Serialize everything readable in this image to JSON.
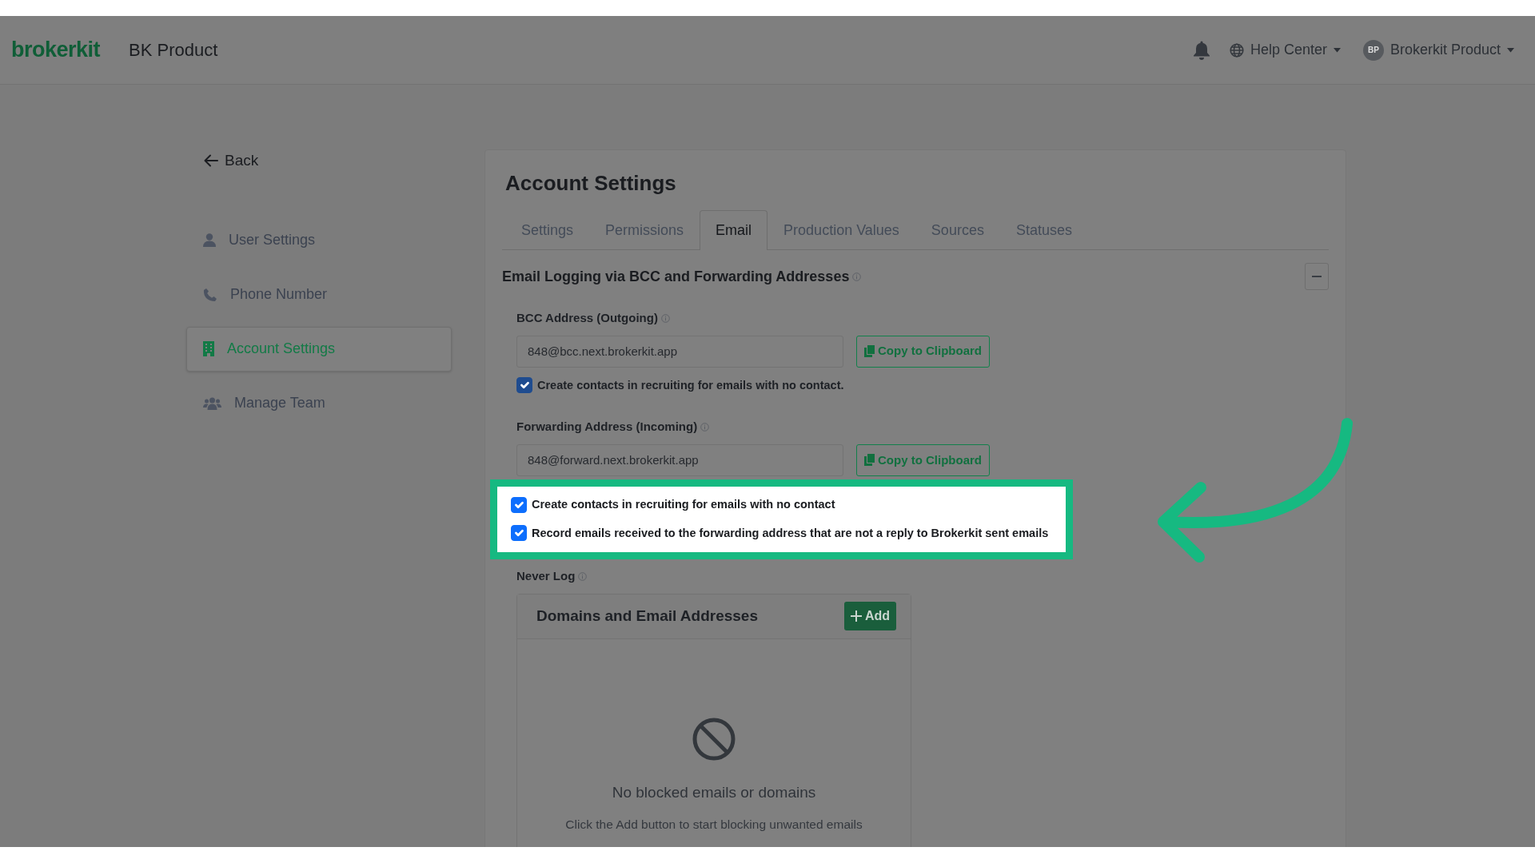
{
  "header": {
    "logo": "brokerkit",
    "workspace": "BK Product",
    "help": "Help Center",
    "avatar": "BP",
    "user": "Brokerkit Product"
  },
  "sidebar": {
    "back": "Back",
    "items": [
      {
        "label": "User Settings",
        "selected": false
      },
      {
        "label": "Phone Number",
        "selected": false
      },
      {
        "label": "Account Settings",
        "selected": true
      },
      {
        "label": "Manage Team",
        "selected": false
      }
    ]
  },
  "main": {
    "title": "Account Settings",
    "tabs": [
      {
        "label": "Settings",
        "selected": false
      },
      {
        "label": "Permissions",
        "selected": false
      },
      {
        "label": "Email",
        "selected": true
      },
      {
        "label": "Production Values",
        "selected": false
      },
      {
        "label": "Sources",
        "selected": false
      },
      {
        "label": "Statuses",
        "selected": false
      }
    ],
    "section": {
      "title": "Email Logging via BCC and Forwarding Addresses",
      "expanded": true,
      "addresses": [
        {
          "label": "BCC Address (Outgoing)",
          "value": "848@bcc.next.brokerkit.app",
          "button": "Copy to Clipboard",
          "checkboxes": [
            {
              "label": "Create contacts in recruiting for emails with no contact.",
              "checked": true
            }
          ]
        },
        {
          "label": "Forwarding Address (Incoming)",
          "value": "848@forward.next.brokerkit.app",
          "button": "Copy to Clipboard",
          "highlighted": true,
          "checkboxes": [
            {
              "label": "Create contacts in recruiting for emails with no contact",
              "checked": true
            },
            {
              "label": "Record emails received to the forwarding address that are not a reply to Brokerkit sent emails",
              "checked": true
            }
          ]
        }
      ],
      "never_log": {
        "label": "Never Log",
        "card_title": "Domains and Email Addresses",
        "add_button": "Add",
        "empty_title": "No blocked emails or domains",
        "empty_text": "Click the Add button to start blocking unwanted emails"
      }
    }
  }
}
